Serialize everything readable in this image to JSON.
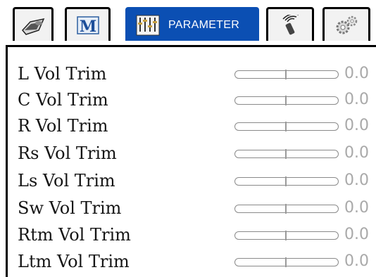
{
  "tabs": [
    {
      "id": "speaker",
      "icon": "speaker-icon",
      "label": ""
    },
    {
      "id": "mode",
      "icon": "m-logo-icon",
      "label": "M"
    },
    {
      "id": "parameter",
      "icon": "equalizer-icon",
      "label": "PARAMETER",
      "active": true
    },
    {
      "id": "remote",
      "icon": "remote-signal-icon",
      "label": ""
    },
    {
      "id": "settings",
      "icon": "gears-icon",
      "label": ""
    }
  ],
  "trims": [
    {
      "label": "L Vol Trim",
      "value": "0.0"
    },
    {
      "label": "C Vol Trim",
      "value": "0.0"
    },
    {
      "label": "R Vol Trim",
      "value": "0.0"
    },
    {
      "label": "Rs Vol Trim",
      "value": "0.0"
    },
    {
      "label": "Ls Vol Trim",
      "value": "0.0"
    },
    {
      "label": "Sw Vol Trim",
      "value": "0.0"
    },
    {
      "label": "Rtm Vol Trim",
      "value": "0.0"
    },
    {
      "label": "Ltm Vol Trim",
      "value": "0.0"
    }
  ],
  "colors": {
    "active_tab": "#0b4fb3",
    "value_text": "#a9a9a9",
    "slider_border": "#8a8a8a"
  }
}
